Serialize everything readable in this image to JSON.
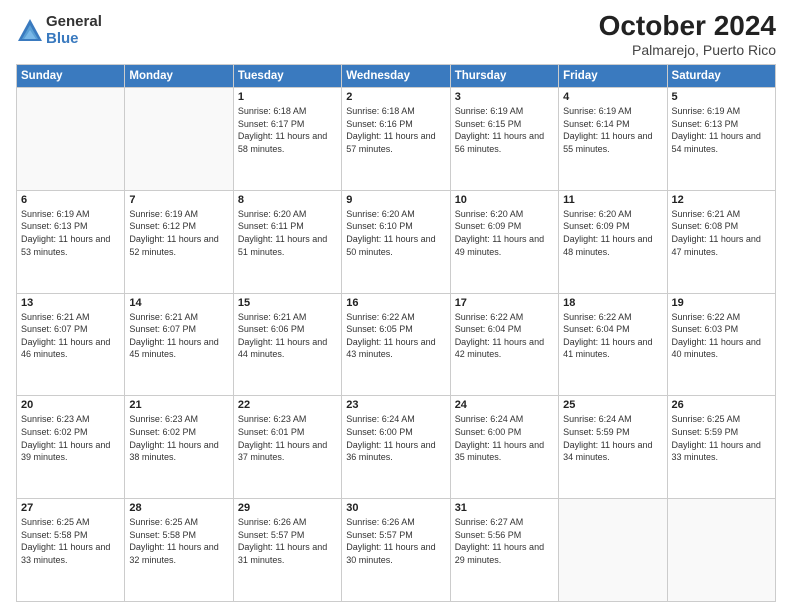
{
  "logo": {
    "general": "General",
    "blue": "Blue"
  },
  "title": "October 2024",
  "subtitle": "Palmarejo, Puerto Rico",
  "days": [
    "Sunday",
    "Monday",
    "Tuesday",
    "Wednesday",
    "Thursday",
    "Friday",
    "Saturday"
  ],
  "weeks": [
    [
      {
        "day": "",
        "sunrise": "",
        "sunset": "",
        "daylight": ""
      },
      {
        "day": "",
        "sunrise": "",
        "sunset": "",
        "daylight": ""
      },
      {
        "day": "1",
        "sunrise": "Sunrise: 6:18 AM",
        "sunset": "Sunset: 6:17 PM",
        "daylight": "Daylight: 11 hours and 58 minutes."
      },
      {
        "day": "2",
        "sunrise": "Sunrise: 6:18 AM",
        "sunset": "Sunset: 6:16 PM",
        "daylight": "Daylight: 11 hours and 57 minutes."
      },
      {
        "day": "3",
        "sunrise": "Sunrise: 6:19 AM",
        "sunset": "Sunset: 6:15 PM",
        "daylight": "Daylight: 11 hours and 56 minutes."
      },
      {
        "day": "4",
        "sunrise": "Sunrise: 6:19 AM",
        "sunset": "Sunset: 6:14 PM",
        "daylight": "Daylight: 11 hours and 55 minutes."
      },
      {
        "day": "5",
        "sunrise": "Sunrise: 6:19 AM",
        "sunset": "Sunset: 6:13 PM",
        "daylight": "Daylight: 11 hours and 54 minutes."
      }
    ],
    [
      {
        "day": "6",
        "sunrise": "Sunrise: 6:19 AM",
        "sunset": "Sunset: 6:13 PM",
        "daylight": "Daylight: 11 hours and 53 minutes."
      },
      {
        "day": "7",
        "sunrise": "Sunrise: 6:19 AM",
        "sunset": "Sunset: 6:12 PM",
        "daylight": "Daylight: 11 hours and 52 minutes."
      },
      {
        "day": "8",
        "sunrise": "Sunrise: 6:20 AM",
        "sunset": "Sunset: 6:11 PM",
        "daylight": "Daylight: 11 hours and 51 minutes."
      },
      {
        "day": "9",
        "sunrise": "Sunrise: 6:20 AM",
        "sunset": "Sunset: 6:10 PM",
        "daylight": "Daylight: 11 hours and 50 minutes."
      },
      {
        "day": "10",
        "sunrise": "Sunrise: 6:20 AM",
        "sunset": "Sunset: 6:09 PM",
        "daylight": "Daylight: 11 hours and 49 minutes."
      },
      {
        "day": "11",
        "sunrise": "Sunrise: 6:20 AM",
        "sunset": "Sunset: 6:09 PM",
        "daylight": "Daylight: 11 hours and 48 minutes."
      },
      {
        "day": "12",
        "sunrise": "Sunrise: 6:21 AM",
        "sunset": "Sunset: 6:08 PM",
        "daylight": "Daylight: 11 hours and 47 minutes."
      }
    ],
    [
      {
        "day": "13",
        "sunrise": "Sunrise: 6:21 AM",
        "sunset": "Sunset: 6:07 PM",
        "daylight": "Daylight: 11 hours and 46 minutes."
      },
      {
        "day": "14",
        "sunrise": "Sunrise: 6:21 AM",
        "sunset": "Sunset: 6:07 PM",
        "daylight": "Daylight: 11 hours and 45 minutes."
      },
      {
        "day": "15",
        "sunrise": "Sunrise: 6:21 AM",
        "sunset": "Sunset: 6:06 PM",
        "daylight": "Daylight: 11 hours and 44 minutes."
      },
      {
        "day": "16",
        "sunrise": "Sunrise: 6:22 AM",
        "sunset": "Sunset: 6:05 PM",
        "daylight": "Daylight: 11 hours and 43 minutes."
      },
      {
        "day": "17",
        "sunrise": "Sunrise: 6:22 AM",
        "sunset": "Sunset: 6:04 PM",
        "daylight": "Daylight: 11 hours and 42 minutes."
      },
      {
        "day": "18",
        "sunrise": "Sunrise: 6:22 AM",
        "sunset": "Sunset: 6:04 PM",
        "daylight": "Daylight: 11 hours and 41 minutes."
      },
      {
        "day": "19",
        "sunrise": "Sunrise: 6:22 AM",
        "sunset": "Sunset: 6:03 PM",
        "daylight": "Daylight: 11 hours and 40 minutes."
      }
    ],
    [
      {
        "day": "20",
        "sunrise": "Sunrise: 6:23 AM",
        "sunset": "Sunset: 6:02 PM",
        "daylight": "Daylight: 11 hours and 39 minutes."
      },
      {
        "day": "21",
        "sunrise": "Sunrise: 6:23 AM",
        "sunset": "Sunset: 6:02 PM",
        "daylight": "Daylight: 11 hours and 38 minutes."
      },
      {
        "day": "22",
        "sunrise": "Sunrise: 6:23 AM",
        "sunset": "Sunset: 6:01 PM",
        "daylight": "Daylight: 11 hours and 37 minutes."
      },
      {
        "day": "23",
        "sunrise": "Sunrise: 6:24 AM",
        "sunset": "Sunset: 6:00 PM",
        "daylight": "Daylight: 11 hours and 36 minutes."
      },
      {
        "day": "24",
        "sunrise": "Sunrise: 6:24 AM",
        "sunset": "Sunset: 6:00 PM",
        "daylight": "Daylight: 11 hours and 35 minutes."
      },
      {
        "day": "25",
        "sunrise": "Sunrise: 6:24 AM",
        "sunset": "Sunset: 5:59 PM",
        "daylight": "Daylight: 11 hours and 34 minutes."
      },
      {
        "day": "26",
        "sunrise": "Sunrise: 6:25 AM",
        "sunset": "Sunset: 5:59 PM",
        "daylight": "Daylight: 11 hours and 33 minutes."
      }
    ],
    [
      {
        "day": "27",
        "sunrise": "Sunrise: 6:25 AM",
        "sunset": "Sunset: 5:58 PM",
        "daylight": "Daylight: 11 hours and 33 minutes."
      },
      {
        "day": "28",
        "sunrise": "Sunrise: 6:25 AM",
        "sunset": "Sunset: 5:58 PM",
        "daylight": "Daylight: 11 hours and 32 minutes."
      },
      {
        "day": "29",
        "sunrise": "Sunrise: 6:26 AM",
        "sunset": "Sunset: 5:57 PM",
        "daylight": "Daylight: 11 hours and 31 minutes."
      },
      {
        "day": "30",
        "sunrise": "Sunrise: 6:26 AM",
        "sunset": "Sunset: 5:57 PM",
        "daylight": "Daylight: 11 hours and 30 minutes."
      },
      {
        "day": "31",
        "sunrise": "Sunrise: 6:27 AM",
        "sunset": "Sunset: 5:56 PM",
        "daylight": "Daylight: 11 hours and 29 minutes."
      },
      {
        "day": "",
        "sunrise": "",
        "sunset": "",
        "daylight": ""
      },
      {
        "day": "",
        "sunrise": "",
        "sunset": "",
        "daylight": ""
      }
    ]
  ]
}
